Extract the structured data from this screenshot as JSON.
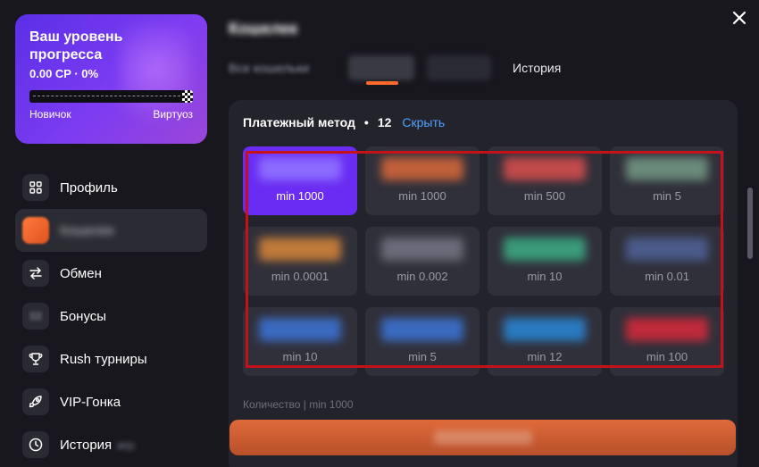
{
  "progress": {
    "title": "Ваш уровень прогресса",
    "points": "0.00 CP · 0%",
    "percent": 0,
    "level_start": "Новичок",
    "level_end": "Виртуоз"
  },
  "nav": {
    "items": [
      {
        "label": "Профиль",
        "icon": "grid-icon"
      },
      {
        "label": "Кошелек",
        "icon": "wallet-icon",
        "active": true
      },
      {
        "label": "Обмен",
        "icon": "exchange-icon"
      },
      {
        "label": "Бонусы",
        "icon": "gift-icon"
      },
      {
        "label": "Rush турниры",
        "icon": "trophy-icon"
      },
      {
        "label": "VIP-Гонка",
        "icon": "rocket-icon"
      },
      {
        "label": "История",
        "icon": "clock-icon",
        "extra": "игр"
      }
    ]
  },
  "wallet": {
    "title": "Кошелек",
    "tabs": [
      "Все кошельки",
      "",
      "",
      "История"
    ],
    "method_label": "Платежный метод",
    "method_count": "12",
    "hide_link": "Скрыть",
    "methods": [
      {
        "min": "min 1000",
        "color": "#8a6bff"
      },
      {
        "min": "min 1000",
        "color": "#c0603a"
      },
      {
        "min": "min 500",
        "color": "#c24a4a"
      },
      {
        "min": "min 5",
        "color": "#6a8a7a"
      },
      {
        "min": "min 0.0001",
        "color": "#c07a3a"
      },
      {
        "min": "min 0.002",
        "color": "#6a6a78"
      },
      {
        "min": "min 10",
        "color": "#3a9a7a"
      },
      {
        "min": "min 0.01",
        "color": "#4a5a8a"
      },
      {
        "min": "min 10",
        "color": "#3a6ac0"
      },
      {
        "min": "min 5",
        "color": "#3a6ac0"
      },
      {
        "min": "min 12",
        "color": "#2a7ac0"
      },
      {
        "min": "min 100",
        "color": "#c02a3a"
      }
    ],
    "amount_label": "Количество | min 1000"
  },
  "colors": {
    "accent": "#6a2cf2",
    "link": "#4ea1ff",
    "orange": "#ff6a2a",
    "highlight": "#c4121a"
  }
}
